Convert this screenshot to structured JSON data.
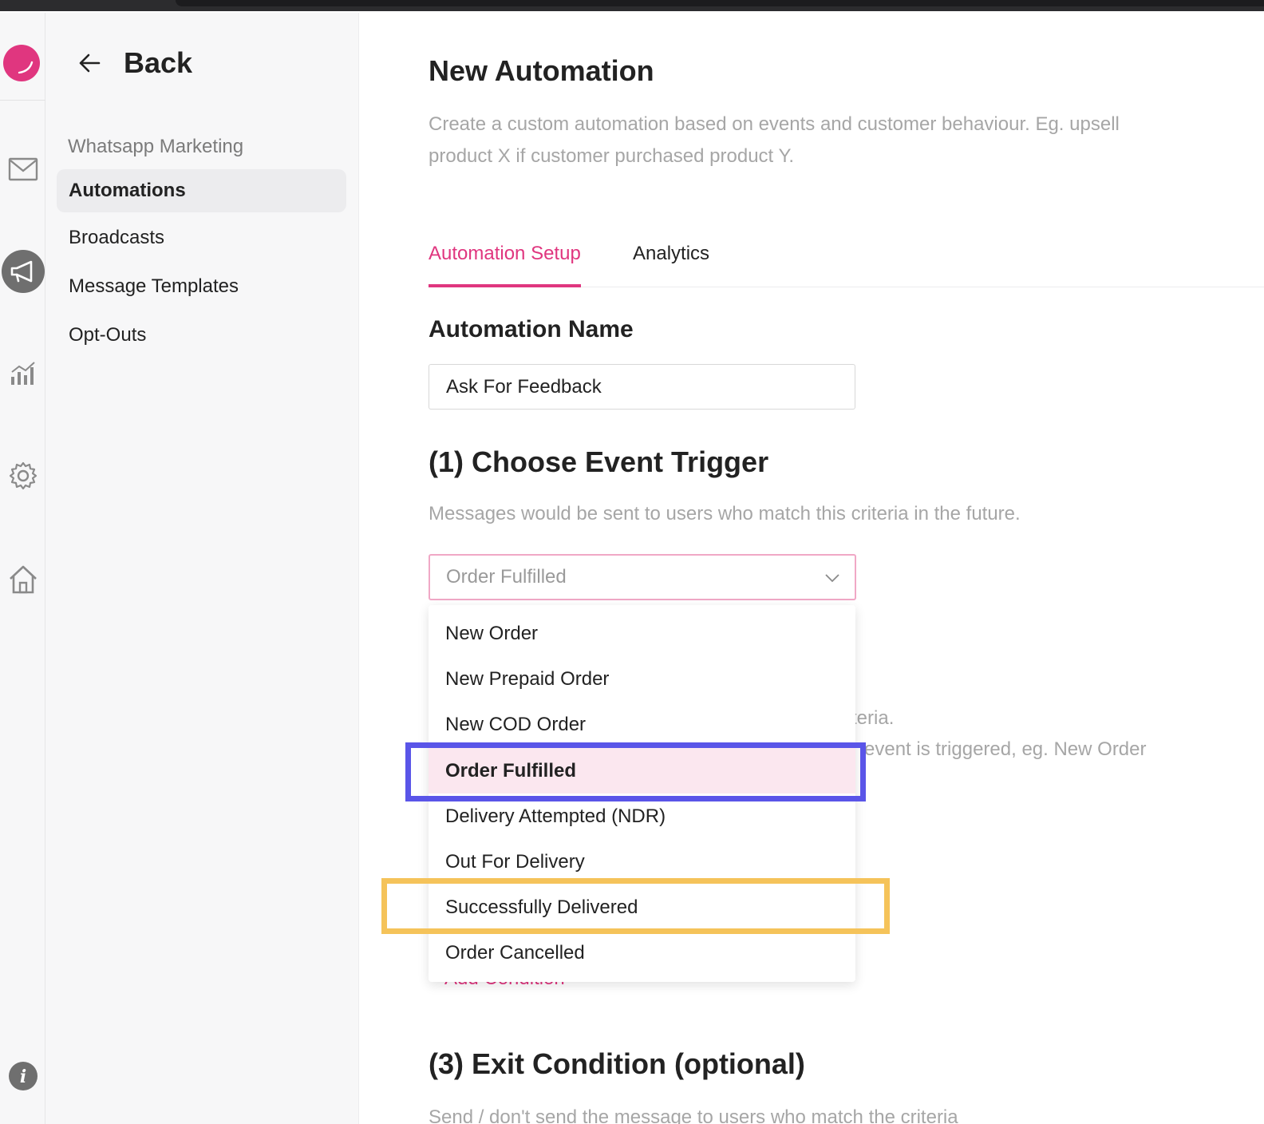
{
  "brand": {
    "accent": "#e0367f",
    "highlight_blue": "#5a55e8",
    "highlight_yellow": "#f5c35a"
  },
  "rail": {
    "icons": [
      "logo-icon",
      "mail-icon",
      "megaphone-icon",
      "analytics-icon",
      "gear-icon",
      "home-icon",
      "info-icon"
    ],
    "info_glyph": "i"
  },
  "sidenav": {
    "back_label": "Back",
    "section": "Whatsapp Marketing",
    "items": [
      {
        "label": "Automations",
        "active": true
      },
      {
        "label": "Broadcasts",
        "active": false
      },
      {
        "label": "Message Templates",
        "active": false
      },
      {
        "label": "Opt-Outs",
        "active": false
      }
    ]
  },
  "main": {
    "title": "New Automation",
    "description": "Create a custom automation based on events and customer behaviour. Eg. upsell product X if customer purchased product Y.",
    "tabs": [
      {
        "label": "Automation Setup",
        "active": true
      },
      {
        "label": "Analytics",
        "active": false
      }
    ],
    "automation_name": {
      "heading": "Automation Name",
      "value": "Ask For Feedback"
    },
    "event_trigger": {
      "heading": "(1) Choose Event Trigger",
      "hint": "Messages would be sent to users who match this criteria in the future.",
      "selected": "Order Fulfilled",
      "options": [
        "New Order",
        "New Prepaid Order",
        "New COD Order",
        "Order Fulfilled",
        "Delivery Attempted (NDR)",
        "Out For Delivery",
        "Successfully Delivered",
        "Order Cancelled"
      ]
    },
    "obscured": {
      "line1": "teria.",
      "line2": "event is triggered, eg. New Order",
      "link": "Add Condition"
    },
    "exit_condition": {
      "heading": "(3) Exit Condition (optional)",
      "subtext": "Send / don't send the message to users who match the criteria"
    }
  }
}
